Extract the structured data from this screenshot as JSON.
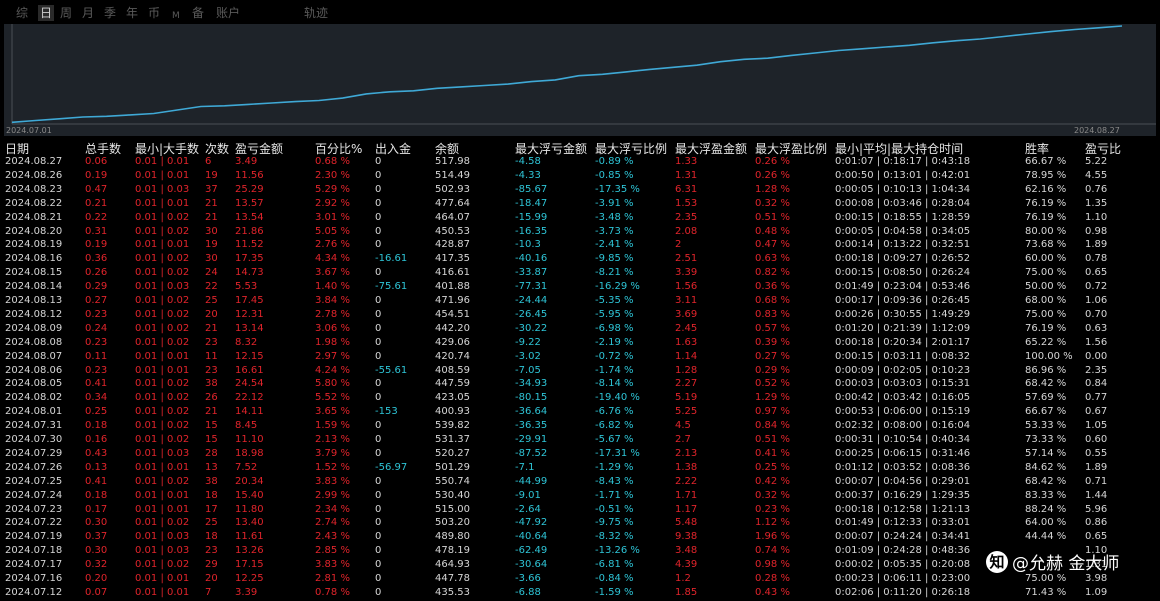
{
  "tabs": [
    "综",
    "日",
    "周",
    "月",
    "季",
    "年",
    "币",
    "M",
    "备",
    "账户",
    "轨迹"
  ],
  "active_tab": "日",
  "colors": {
    "line": "#3fa9d6",
    "profit": "#e0242b",
    "deposit": "#2ec4d6",
    "text": "#d6d6d6",
    "chart_bg": "#1e2329"
  },
  "chart_data": {
    "type": "line",
    "x_start": "2024.07.01",
    "x_end": "2024.08.27",
    "series": [
      {
        "values": [
          0.5,
          1,
          1.5,
          2,
          2.2,
          2.6,
          3,
          4,
          5,
          5.2,
          5.6,
          6,
          6.4,
          6.7,
          7.4,
          8.6,
          9.2,
          9.5,
          10.2,
          10.6,
          11,
          11.4,
          12.1,
          12.6,
          13.8,
          14.2,
          14.9,
          15.6,
          16.2,
          16.8,
          17.8,
          18.5,
          18.8,
          19.6,
          20.3,
          21,
          21.5,
          22,
          22.5,
          23.2,
          23.8,
          24.3,
          25,
          25.7,
          26.4,
          27,
          27.5,
          28
        ]
      }
    ]
  },
  "table": {
    "headers": [
      "日期",
      "总手数",
      "最小|大手数",
      "次数",
      "盈亏金额",
      "百分比%",
      "出入金",
      "余额",
      "最大浮亏金额",
      "最大浮亏比例",
      "最大浮盈金额",
      "最大浮盈比例",
      "最小|平均|最大持仓时间",
      "胜率",
      "盈亏比"
    ],
    "rows": [
      [
        "2024.08.27",
        "0.06",
        "0.01 | 0.01",
        "6",
        "3.49",
        "0.68 %",
        "0",
        "517.98",
        "-4.58",
        "-0.89 %",
        "1.33",
        "0.26 %",
        "0:01:07 | 0:18:17 | 0:43:18",
        "66.67 %",
        "5.22"
      ],
      [
        "2024.08.26",
        "0.19",
        "0.01 | 0.01",
        "19",
        "11.56",
        "2.30 %",
        "0",
        "514.49",
        "-4.33",
        "-0.85 %",
        "1.31",
        "0.26 %",
        "0:00:50 | 0:13:01 | 0:42:01",
        "78.95 %",
        "4.55"
      ],
      [
        "2024.08.23",
        "0.47",
        "0.01 | 0.03",
        "37",
        "25.29",
        "5.29 %",
        "0",
        "502.93",
        "-85.67",
        "-17.35 %",
        "6.31",
        "1.28 %",
        "0:00:05 | 0:10:13 | 1:04:34",
        "62.16 %",
        "0.76"
      ],
      [
        "2024.08.22",
        "0.21",
        "0.01 | 0.01",
        "21",
        "13.57",
        "2.92 %",
        "0",
        "477.64",
        "-18.47",
        "-3.91 %",
        "1.53",
        "0.32 %",
        "0:00:08 | 0:03:46 | 0:28:04",
        "76.19 %",
        "1.35"
      ],
      [
        "2024.08.21",
        "0.22",
        "0.01 | 0.02",
        "21",
        "13.54",
        "3.01 %",
        "0",
        "464.07",
        "-15.99",
        "-3.48 %",
        "2.35",
        "0.51 %",
        "0:00:15 | 0:18:55 | 1:28:59",
        "76.19 %",
        "1.10"
      ],
      [
        "2024.08.20",
        "0.31",
        "0.01 | 0.02",
        "30",
        "21.86",
        "5.05 %",
        "0",
        "450.53",
        "-16.35",
        "-3.73 %",
        "2.08",
        "0.48 %",
        "0:00:05 | 0:04:58 | 0:34:05",
        "80.00 %",
        "0.98"
      ],
      [
        "2024.08.19",
        "0.19",
        "0.01 | 0.01",
        "19",
        "11.52",
        "2.76 %",
        "0",
        "428.87",
        "-10.3",
        "-2.41 %",
        "2",
        "0.47 %",
        "0:00:14 | 0:13:22 | 0:32:51",
        "73.68 %",
        "1.89"
      ],
      [
        "2024.08.16",
        "0.36",
        "0.01 | 0.02",
        "30",
        "17.35",
        "4.34 %",
        "-16.61",
        "417.35",
        "-40.16",
        "-9.85 %",
        "2.51",
        "0.63 %",
        "0:00:18 | 0:09:27 | 0:26:52",
        "60.00 %",
        "0.78"
      ],
      [
        "2024.08.15",
        "0.26",
        "0.01 | 0.02",
        "24",
        "14.73",
        "3.67 %",
        "0",
        "416.61",
        "-33.87",
        "-8.21 %",
        "3.39",
        "0.82 %",
        "0:00:15 | 0:08:50 | 0:26:24",
        "75.00 %",
        "0.65"
      ],
      [
        "2024.08.14",
        "0.29",
        "0.01 | 0.03",
        "22",
        "5.53",
        "1.40 %",
        "-75.61",
        "401.88",
        "-77.31",
        "-16.29 %",
        "1.56",
        "0.36 %",
        "0:01:49 | 0:23:04 | 0:53:46",
        "50.00 %",
        "0.72"
      ],
      [
        "2024.08.13",
        "0.27",
        "0.01 | 0.02",
        "25",
        "17.45",
        "3.84 %",
        "0",
        "471.96",
        "-24.44",
        "-5.35 %",
        "3.11",
        "0.68 %",
        "0:00:17 | 0:09:36 | 0:26:45",
        "68.00 %",
        "1.06"
      ],
      [
        "2024.08.12",
        "0.23",
        "0.01 | 0.02",
        "20",
        "12.31",
        "2.78 %",
        "0",
        "454.51",
        "-26.45",
        "-5.95 %",
        "3.69",
        "0.83 %",
        "0:00:26 | 0:30:55 | 1:49:29",
        "75.00 %",
        "0.70"
      ],
      [
        "2024.08.09",
        "0.24",
        "0.01 | 0.02",
        "21",
        "13.14",
        "3.06 %",
        "0",
        "442.20",
        "-30.22",
        "-6.98 %",
        "2.45",
        "0.57 %",
        "0:01:20 | 0:21:39 | 1:12:09",
        "76.19 %",
        "0.63"
      ],
      [
        "2024.08.08",
        "0.23",
        "0.01 | 0.02",
        "23",
        "8.32",
        "1.98 %",
        "0",
        "429.06",
        "-9.22",
        "-2.19 %",
        "1.63",
        "0.39 %",
        "0:00:18 | 0:20:34 | 2:01:17",
        "65.22 %",
        "1.56"
      ],
      [
        "2024.08.07",
        "0.11",
        "0.01 | 0.01",
        "11",
        "12.15",
        "2.97 %",
        "0",
        "420.74",
        "-3.02",
        "-0.72 %",
        "1.14",
        "0.27 %",
        "0:00:15 | 0:03:11 | 0:08:32",
        "100.00 %",
        "0.00"
      ],
      [
        "2024.08.06",
        "0.23",
        "0.01 | 0.01",
        "23",
        "16.61",
        "4.24 %",
        "-55.61",
        "408.59",
        "-7.05",
        "-1.74 %",
        "1.28",
        "0.29 %",
        "0:00:09 | 0:02:05 | 0:10:23",
        "86.96 %",
        "2.35"
      ],
      [
        "2024.08.05",
        "0.41",
        "0.01 | 0.02",
        "38",
        "24.54",
        "5.80 %",
        "0",
        "447.59",
        "-34.93",
        "-8.14 %",
        "2.27",
        "0.52 %",
        "0:00:03 | 0:03:03 | 0:15:31",
        "68.42 %",
        "0.84"
      ],
      [
        "2024.08.02",
        "0.34",
        "0.01 | 0.02",
        "26",
        "22.12",
        "5.52 %",
        "0",
        "423.05",
        "-80.15",
        "-19.40 %",
        "5.19",
        "1.29 %",
        "0:00:42 | 0:03:42 | 0:16:05",
        "57.69 %",
        "0.77"
      ],
      [
        "2024.08.01",
        "0.25",
        "0.01 | 0.02",
        "21",
        "14.11",
        "3.65 %",
        "-153",
        "400.93",
        "-36.64",
        "-6.76 %",
        "5.25",
        "0.97 %",
        "0:00:53 | 0:06:00 | 0:15:19",
        "66.67 %",
        "0.67"
      ],
      [
        "2024.07.31",
        "0.18",
        "0.01 | 0.02",
        "15",
        "8.45",
        "1.59 %",
        "0",
        "539.82",
        "-36.35",
        "-6.82 %",
        "4.5",
        "0.84 %",
        "0:02:32 | 0:08:00 | 0:16:04",
        "53.33 %",
        "1.05"
      ],
      [
        "2024.07.30",
        "0.16",
        "0.01 | 0.02",
        "15",
        "11.10",
        "2.13 %",
        "0",
        "531.37",
        "-29.91",
        "-5.67 %",
        "2.7",
        "0.51 %",
        "0:00:31 | 0:10:54 | 0:40:34",
        "73.33 %",
        "0.60"
      ],
      [
        "2024.07.29",
        "0.43",
        "0.01 | 0.03",
        "28",
        "18.98",
        "3.79 %",
        "0",
        "520.27",
        "-87.52",
        "-17.31 %",
        "2.13",
        "0.41 %",
        "0:00:25 | 0:06:15 | 0:31:46",
        "57.14 %",
        "0.55"
      ],
      [
        "2024.07.26",
        "0.13",
        "0.01 | 0.01",
        "13",
        "7.52",
        "1.52 %",
        "-56.97",
        "501.29",
        "-7.1",
        "-1.29 %",
        "1.38",
        "0.25 %",
        "0:01:12 | 0:03:52 | 0:08:36",
        "84.62 %",
        "1.89"
      ],
      [
        "2024.07.25",
        "0.41",
        "0.01 | 0.02",
        "38",
        "20.34",
        "3.83 %",
        "0",
        "550.74",
        "-44.99",
        "-8.43 %",
        "2.22",
        "0.42 %",
        "0:00:07 | 0:04:56 | 0:29:01",
        "68.42 %",
        "0.71"
      ],
      [
        "2024.07.24",
        "0.18",
        "0.01 | 0.01",
        "18",
        "15.40",
        "2.99 %",
        "0",
        "530.40",
        "-9.01",
        "-1.71 %",
        "1.71",
        "0.32 %",
        "0:00:37 | 0:16:29 | 1:29:35",
        "83.33 %",
        "1.44"
      ],
      [
        "2024.07.23",
        "0.17",
        "0.01 | 0.01",
        "17",
        "11.80",
        "2.34 %",
        "0",
        "515.00",
        "-2.64",
        "-0.51 %",
        "1.17",
        "0.23 %",
        "0:00:18 | 0:12:58 | 1:21:13",
        "88.24 %",
        "5.96"
      ],
      [
        "2024.07.22",
        "0.30",
        "0.01 | 0.02",
        "25",
        "13.40",
        "2.74 %",
        "0",
        "503.20",
        "-47.92",
        "-9.75 %",
        "5.48",
        "1.12 %",
        "0:01:49 | 0:12:33 | 0:33:01",
        "64.00 %",
        "0.86"
      ],
      [
        "2024.07.19",
        "0.37",
        "0.01 | 0.03",
        "18",
        "11.61",
        "2.43 %",
        "0",
        "489.80",
        "-40.64",
        "-8.32 %",
        "9.38",
        "1.96 %",
        "0:00:07 | 0:24:24 | 0:34:41",
        "44.44 %",
        "0.65"
      ],
      [
        "2024.07.18",
        "0.30",
        "0.01 | 0.03",
        "23",
        "13.26",
        "2.85 %",
        "0",
        "478.19",
        "-62.49",
        "-13.26 %",
        "3.48",
        "0.74 %",
        "0:01:09 | 0:24:28 | 0:48:36",
        "",
        "1.10"
      ],
      [
        "2024.07.17",
        "0.32",
        "0.01 | 0.02",
        "29",
        "17.15",
        "3.83 %",
        "0",
        "464.93",
        "-30.64",
        "-6.81 %",
        "4.39",
        "0.98 %",
        "0:00:02 | 0:05:35 | 0:20:08",
        "",
        "1.31"
      ],
      [
        "2024.07.16",
        "0.20",
        "0.01 | 0.01",
        "20",
        "12.25",
        "2.81 %",
        "0",
        "447.78",
        "-3.66",
        "-0.84 %",
        "1.2",
        "0.28 %",
        "0:00:23 | 0:06:11 | 0:23:00",
        "75.00 %",
        "3.98"
      ],
      [
        "2024.07.12",
        "0.07",
        "0.01 | 0.01",
        "7",
        "3.39",
        "0.78 %",
        "0",
        "435.53",
        "-6.88",
        "-1.59 %",
        "1.85",
        "0.43 %",
        "0:02:06 | 0:11:20 | 0:26:18",
        "71.43 %",
        "1.09"
      ]
    ]
  },
  "watermark": {
    "icon": "zhihu-logo-icon",
    "icon_glyph": "知",
    "text": "@允赫 金大师"
  }
}
